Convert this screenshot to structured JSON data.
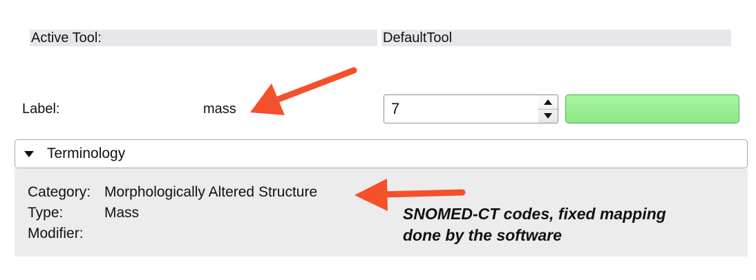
{
  "active_tool": {
    "label": "Active Tool:",
    "value": "DefaultTool"
  },
  "label_row": {
    "label": "Label:",
    "name": "mass",
    "spin_value": "7",
    "color": "#8ee887"
  },
  "terminology": {
    "title": "Terminology",
    "category_label": "Category:",
    "category_value": "Morphologically Altered Structure",
    "type_label": "Type:",
    "type_value": "Mass",
    "modifier_label": "Modifier:",
    "modifier_value": ""
  },
  "annotation": {
    "line1": "SNOMED-CT codes, fixed mapping",
    "line2": "done by the software",
    "arrow_color": "#f4502a"
  }
}
